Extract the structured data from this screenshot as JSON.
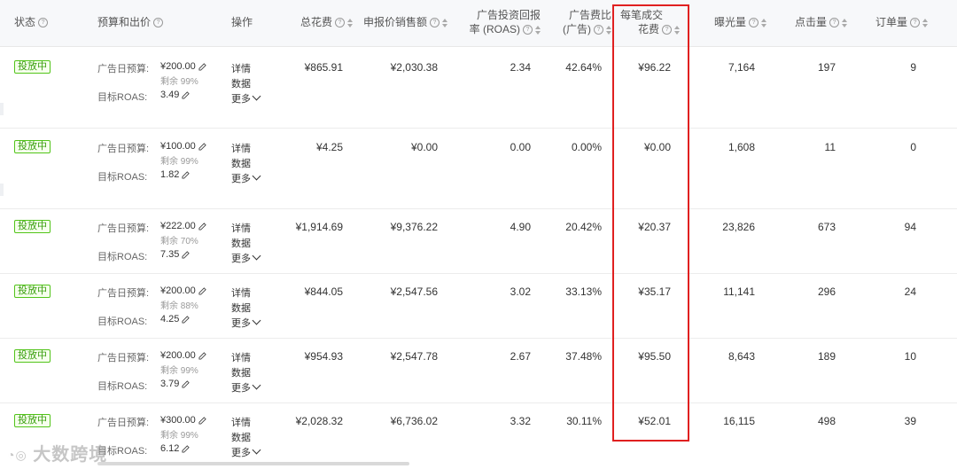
{
  "header": {
    "status": "状态",
    "budget_bid": "预算和出价",
    "operation": "操作",
    "total_spend": "总花费",
    "reported_sales": "申报价销售额",
    "roas_line1": "广告投资回报",
    "roas_line2": "率 (ROAS)",
    "acos_line1": "广告费比",
    "acos_line2": "(广告)",
    "cpo_line1": "每笔成交",
    "cpo_line2": "花费",
    "impressions": "曝光量",
    "clicks": "点击量",
    "orders": "订单量"
  },
  "labels": {
    "daily_budget": "广告日预算:",
    "target_roas": "目标ROAS:",
    "detail": "详情",
    "data": "数据",
    "more": "更多"
  },
  "rows": [
    {
      "status": "投放中",
      "budget": "¥200.00",
      "remain": "剩余 99%",
      "roas_target": "3.49",
      "total_spend": "¥865.91",
      "sales": "¥2,030.38",
      "roas": "2.34",
      "acos": "42.64%",
      "cpo": "¥96.22",
      "impressions": "7,164",
      "clicks": "197",
      "orders": "9"
    },
    {
      "status": "投放中",
      "budget": "¥100.00",
      "remain": "剩余 99%",
      "roas_target": "1.82",
      "total_spend": "¥4.25",
      "sales": "¥0.00",
      "roas": "0.00",
      "acos": "0.00%",
      "cpo": "¥0.00",
      "impressions": "1,608",
      "clicks": "11",
      "orders": "0"
    },
    {
      "status": "投放中",
      "budget": "¥222.00",
      "remain": "剩余 70%",
      "roas_target": "7.35",
      "total_spend": "¥1,914.69",
      "sales": "¥9,376.22",
      "roas": "4.90",
      "acos": "20.42%",
      "cpo": "¥20.37",
      "impressions": "23,826",
      "clicks": "673",
      "orders": "94"
    },
    {
      "status": "投放中",
      "budget": "¥200.00",
      "remain": "剩余 88%",
      "roas_target": "4.25",
      "total_spend": "¥844.05",
      "sales": "¥2,547.56",
      "roas": "3.02",
      "acos": "33.13%",
      "cpo": "¥35.17",
      "impressions": "11,141",
      "clicks": "296",
      "orders": "24"
    },
    {
      "status": "投放中",
      "budget": "¥200.00",
      "remain": "剩余 99%",
      "roas_target": "3.79",
      "total_spend": "¥954.93",
      "sales": "¥2,547.78",
      "roas": "2.67",
      "acos": "37.48%",
      "cpo": "¥95.50",
      "impressions": "8,643",
      "clicks": "189",
      "orders": "10"
    },
    {
      "status": "投放中",
      "budget": "¥300.00",
      "remain": "剩余 99%",
      "roas_target": "6.12",
      "total_spend": "¥2,028.32",
      "sales": "¥6,736.02",
      "roas": "3.32",
      "acos": "30.11%",
      "cpo": "¥52.01",
      "impressions": "16,115",
      "clicks": "498",
      "orders": "39"
    }
  ],
  "watermark": "大数跨境",
  "colors": {
    "accent_highlight": "#e02020",
    "status_green": "#389e0d"
  }
}
